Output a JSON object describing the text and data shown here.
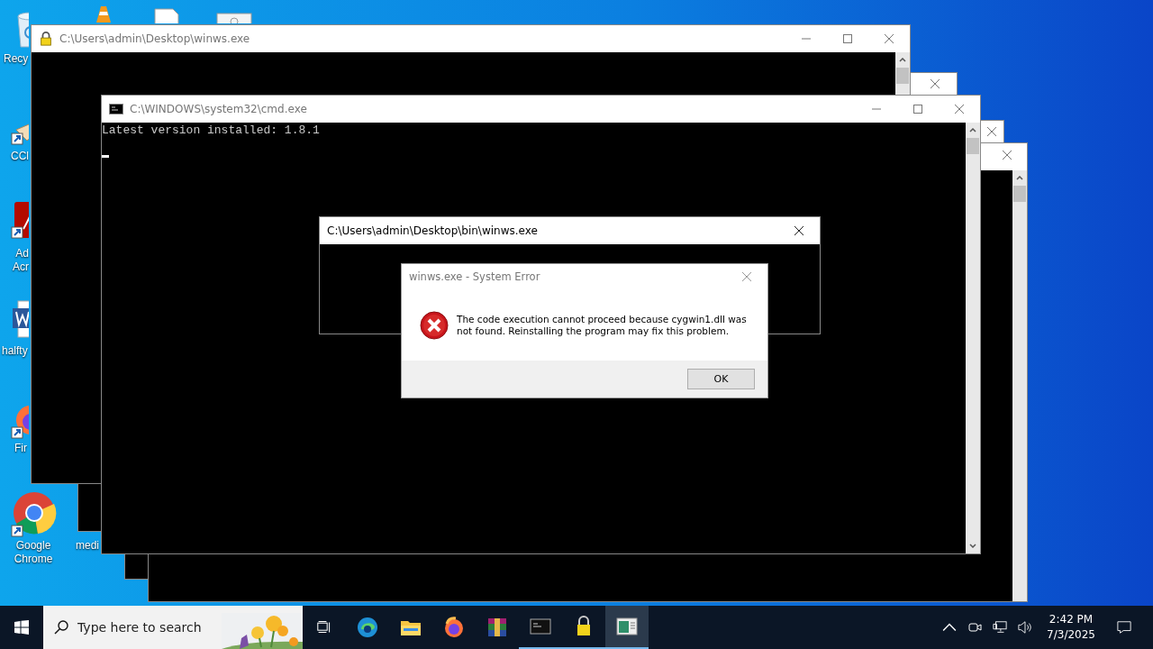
{
  "desktop_icons": [
    {
      "kind": "recycle-bin",
      "label": "Recy"
    },
    {
      "kind": "cone"
    },
    {
      "kind": "document"
    },
    {
      "kind": "settings-window"
    },
    {
      "kind": "cleaner",
      "label": "CCl"
    },
    {
      "kind": "pdf",
      "label": "Ad Acr"
    },
    {
      "kind": "word",
      "label": "halfty"
    },
    {
      "kind": "firefox",
      "label": "Fir"
    },
    {
      "kind": "chrome",
      "label": "Google Chrome"
    },
    {
      "kind": "hidden",
      "label": "medi"
    }
  ],
  "background_windows": [
    {
      "kind": "console",
      "close_button": true
    },
    {
      "kind": "console",
      "close_button": true
    },
    {
      "kind": "console",
      "close_button": true
    }
  ],
  "winws_window": {
    "title": "C:\\Users\\admin\\Desktop\\winws.exe"
  },
  "cmd_window": {
    "title": "C:\\WINDOWS\\system32\\cmd.exe",
    "lines": [
      "Latest version installed: 1.8.1"
    ]
  },
  "bin_window": {
    "title": "C:\\Users\\admin\\Desktop\\bin\\winws.exe"
  },
  "error_dialog": {
    "title": "winws.exe - System Error",
    "message": "The code execution cannot proceed because cygwin1.dll was not found. Reinstalling the program may fix this problem.",
    "button": "OK"
  },
  "taskbar": {
    "search": {
      "placeholder": "Type here to search"
    },
    "apps": [
      {
        "kind": "task-view",
        "running": false,
        "selected": false
      },
      {
        "kind": "edge",
        "running": false,
        "selected": false
      },
      {
        "kind": "explorer",
        "running": false,
        "selected": false
      },
      {
        "kind": "firefox",
        "running": false,
        "selected": false
      },
      {
        "kind": "archive",
        "running": false,
        "selected": false
      },
      {
        "kind": "console",
        "running": true,
        "selected": false
      },
      {
        "kind": "lock",
        "running": true,
        "selected": false
      },
      {
        "kind": "window",
        "running": true,
        "selected": true
      }
    ],
    "time": "2:42 PM",
    "date": "7/3/2025"
  }
}
